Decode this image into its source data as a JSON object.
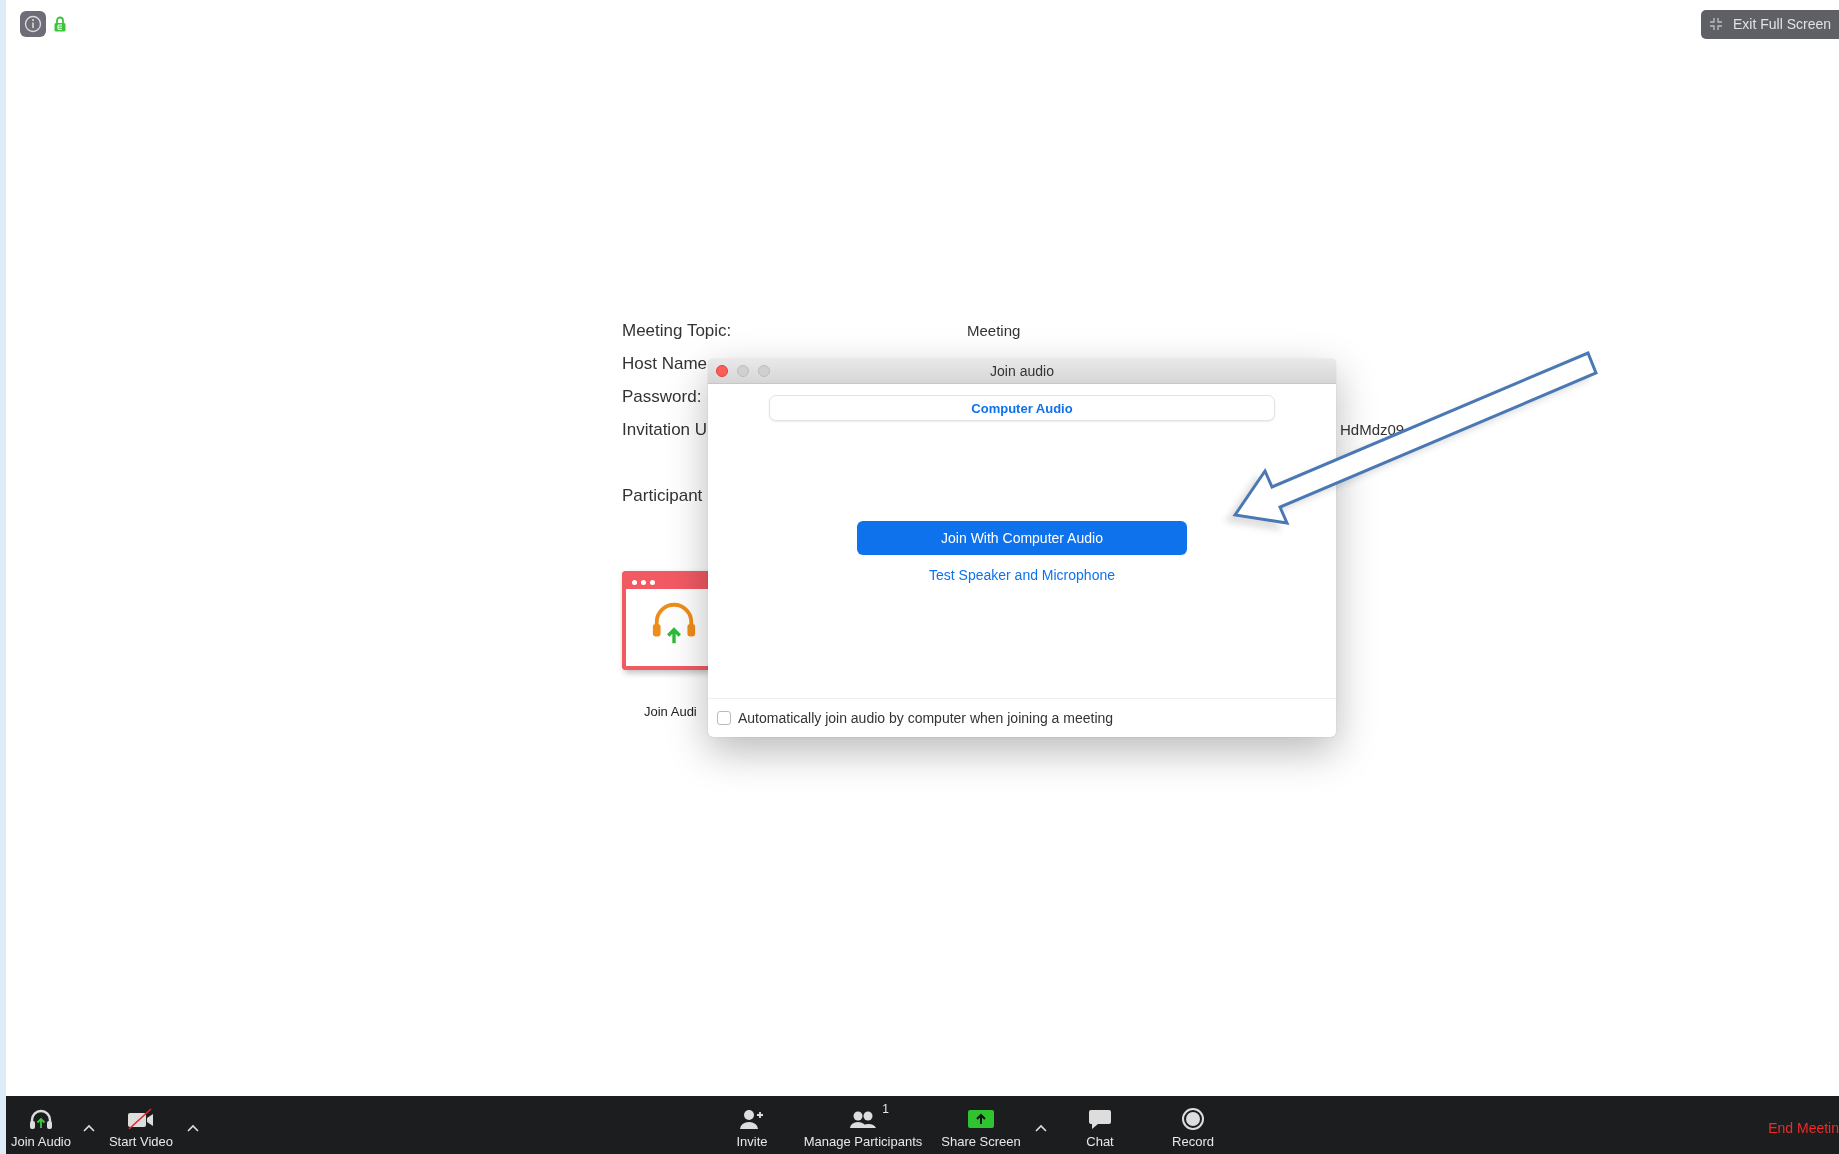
{
  "top_bar": {
    "exit_button": "Exit Full Screen"
  },
  "meeting_info": [
    {
      "label": "Meeting Topic:",
      "value": "Meeting"
    },
    {
      "label": "Host Name"
    },
    {
      "label": "Password:"
    },
    {
      "label": "Invitation U",
      "value": "HdMdz09"
    },
    {
      "label": "Participant"
    }
  ],
  "join_audio_tile": {
    "label": "Join Audi"
  },
  "dialog": {
    "title": "Join audio",
    "tabs": [
      {
        "label": "Computer Audio",
        "selected": true
      }
    ],
    "primary_button": "Join With Computer Audio",
    "link": "Test Speaker and Microphone",
    "auto_join": {
      "label": "Automatically join audio by computer when joining a meeting",
      "checked": false
    }
  },
  "toolbar": [
    {
      "kind": "audio",
      "label": "Join Audio"
    },
    {
      "kind": "caret"
    },
    {
      "kind": "video",
      "label": "Start Video"
    },
    {
      "kind": "caret"
    },
    {
      "kind": "invite",
      "label": "Invite"
    },
    {
      "kind": "participants",
      "label": "Manage Participants",
      "count": "1"
    },
    {
      "kind": "share",
      "label": "Share Screen"
    },
    {
      "kind": "caret"
    },
    {
      "kind": "chat",
      "label": "Chat"
    },
    {
      "kind": "record",
      "label": "Record"
    }
  ],
  "end_button": "End Meetin"
}
